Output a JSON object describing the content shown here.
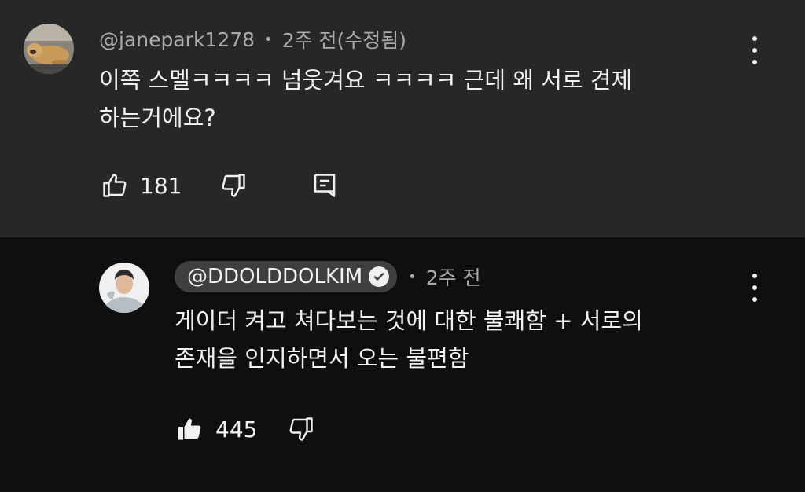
{
  "comment": {
    "author": "@janepark1278",
    "separator": "•",
    "time": "2주 전(수정됨)",
    "lines": [
      "이쪽 스멜ㅋㅋㅋㅋ 넘웃겨요 ㅋㅋㅋㅋ 근데 왜 서로 견제",
      "하는거에요?"
    ],
    "likes": "181"
  },
  "reply": {
    "author": "@DDOLDDOLKIM",
    "separator": "•",
    "time": "2주 전",
    "lines": [
      "게이더 켜고 쳐다보는 것에 대한 불쾌함 + 서로의",
      "존재을 인지하면서 오는 불편함"
    ],
    "likes": "445"
  },
  "icons": {
    "like": "thumbs-up-icon",
    "dislike": "thumbs-down-icon",
    "reply": "reply-icon",
    "menu": "more-vert-icon",
    "verified": "check-circle-icon"
  },
  "colors": {
    "top_bg": "#272727",
    "reply_bg": "#0f0f0f",
    "meta_text": "#aaaaaa",
    "chip_bg": "#3f3f3f"
  }
}
